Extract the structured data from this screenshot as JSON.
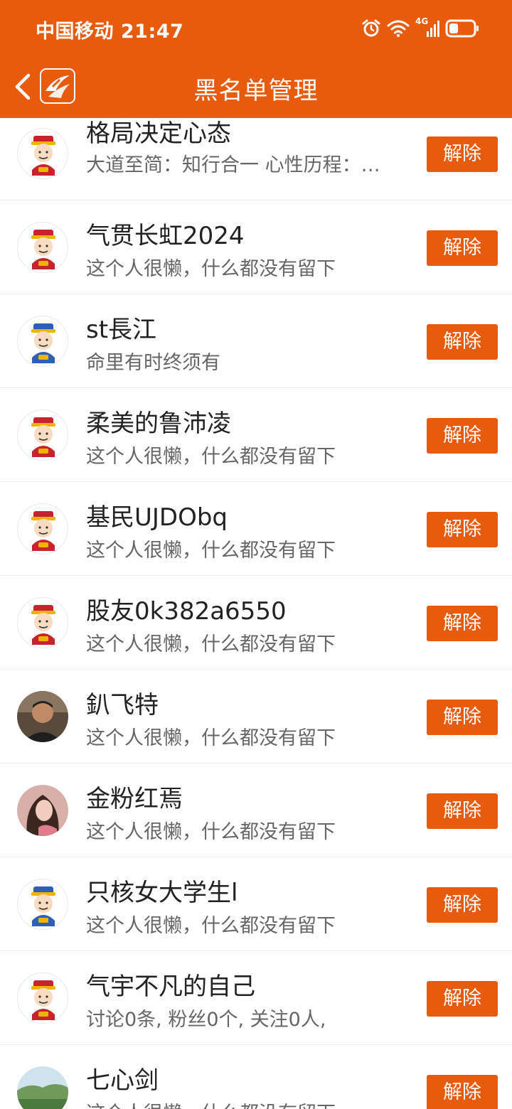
{
  "status_bar": {
    "carrier_time": "中国移动 21:47",
    "network": "4G"
  },
  "nav": {
    "title": "黑名单管理"
  },
  "action_label": "解除",
  "colors": {
    "brand": "#e85a0c",
    "name_text": "#222222",
    "sub_text": "#666666"
  },
  "users": [
    {
      "name": "格局决定心态",
      "bio": "大道至简：知行合一 心性历程：…",
      "avatar": "caishen-red"
    },
    {
      "name": "气贯长虹2024",
      "bio": "这个人很懒，什么都没有留下",
      "avatar": "caishen-red"
    },
    {
      "name": "st長江",
      "bio": "命里有时终须有",
      "avatar": "caishen-blue"
    },
    {
      "name": "柔美的鲁沛凌",
      "bio": "这个人很懒，什么都没有留下",
      "avatar": "caishen-red"
    },
    {
      "name": "基民UJDObq",
      "bio": "这个人很懒，什么都没有留下",
      "avatar": "caishen-red"
    },
    {
      "name": "股友0k382a6550",
      "bio": "这个人很懒，什么都没有留下",
      "avatar": "caishen-red"
    },
    {
      "name": "釟飞特",
      "bio": "这个人很懒，什么都没有留下",
      "avatar": "photo-man"
    },
    {
      "name": "金粉红焉",
      "bio": "这个人很懒，什么都没有留下",
      "avatar": "photo-woman"
    },
    {
      "name": "只核女大学生l",
      "bio": "这个人很懒，什么都没有留下",
      "avatar": "caishen-blue"
    },
    {
      "name": "气宇不凡的自己",
      "bio": "讨论0条, 粉丝0个, 关注0人,",
      "avatar": "caishen-red"
    },
    {
      "name": "七心剑",
      "bio": "这个人很懒，什么都没有留下",
      "avatar": "photo-landscape"
    }
  ]
}
